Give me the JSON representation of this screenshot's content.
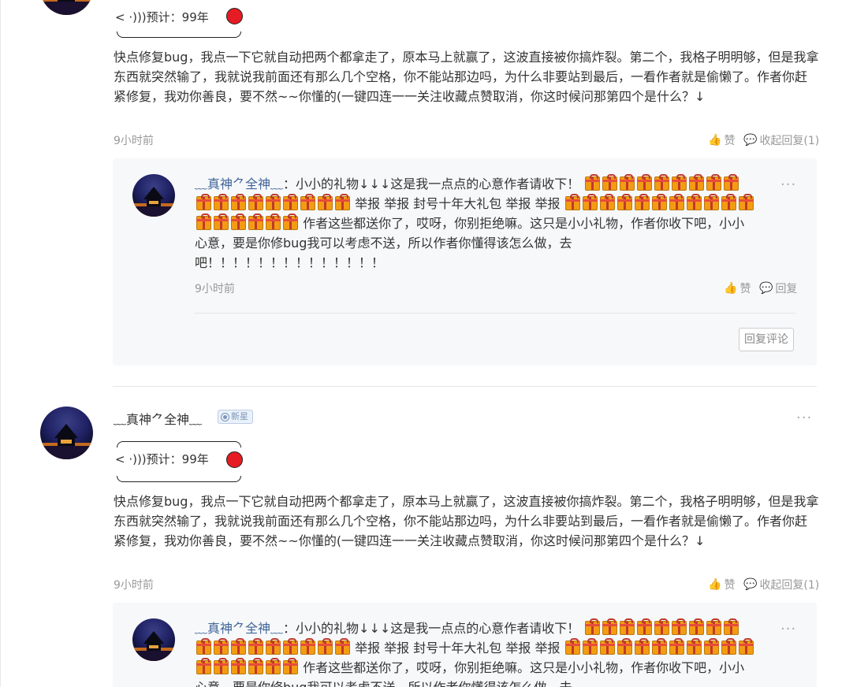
{
  "comments": [
    {
      "username": "",
      "badge": "",
      "signature": "< ·)))预计：99年",
      "text": "快点修复bug，我点一下它就自动把两个都拿走了，原本马上就赢了，这波直接被你搞炸裂。第二个，我格子明明够，但是我拿东西就突然输了，我就说我前面还有那么几个空格，你不能站那边吗，为什么非要站到最后，一看作者就是偷懒了。作者你赶紧修复，我劝你善良，要不然~~你懂的(一键四连一一关注收藏点赞取消，你这时候问那第四个是什么？↓",
      "time": "9小时前",
      "like_label": "赞",
      "collapse_label": "收起回复(1)",
      "reply": {
        "username": "﹏真神⺈全神﹏",
        "separator": "：",
        "part1": "小小的礼物↓↓↓这是我一点点的心意作者请收下！",
        "part2": "举报 举报 封号十年大礼包 举报 举报",
        "part3": "作者这些都送你了，哎呀，你别拒绝嘛。这只是小小礼物，作者你收下吧，小小心意，要是你修bug我可以考虑不送，所以作者你懂得该怎么做，去吧！！！！！！！！！！！！！！",
        "time": "9小时前",
        "like_label": "赞",
        "reply_label": "回复",
        "button_label": "回复评论"
      }
    },
    {
      "username": "﹏真神⺈全神﹏",
      "badge": "新星",
      "signature": "< ·)))预计：99年",
      "text": "快点修复bug，我点一下它就自动把两个都拿走了，原本马上就赢了，这波直接被你搞炸裂。第二个，我格子明明够，但是我拿东西就突然输了，我就说我前面还有那么几个空格，你不能站那边吗，为什么非要站到最后，一看作者就是偷懒了。作者你赶紧修复，我劝你善良，要不然~~你懂的(一键四连一一关注收藏点赞取消，你这时候问那第四个是什么？↓",
      "time": "9小时前",
      "like_label": "赞",
      "collapse_label": "收起回复(1)",
      "reply": {
        "username": "﹏真神⺈全神﹏",
        "separator": "：",
        "part1": "小小的礼物↓↓↓这是我一点点的心意作者请收下！",
        "part2": "举报 举报 封号十年大礼包 举报 举报",
        "part3": "作者这些都送你了，哎呀，你别拒绝嘛。这只是小小礼物，作者你收下吧，小小心意，要是你修bug我可以考虑不送，所以作者你懂得该怎么做，去吧！！！！！！！！！！！！！！"
      }
    }
  ],
  "more_label": "···",
  "icons": {
    "like": "thumbs-up-icon",
    "comment": "comment-bubble-icon",
    "gift": "gift-box-icon",
    "more": "more-dots-icon",
    "checkmark_dot": "star-badge-icon"
  },
  "colors": {
    "username_link": "#406599",
    "signature_dot": "#e51c23",
    "reply_background": "#f7f8fa",
    "meta_text": "#999999"
  }
}
